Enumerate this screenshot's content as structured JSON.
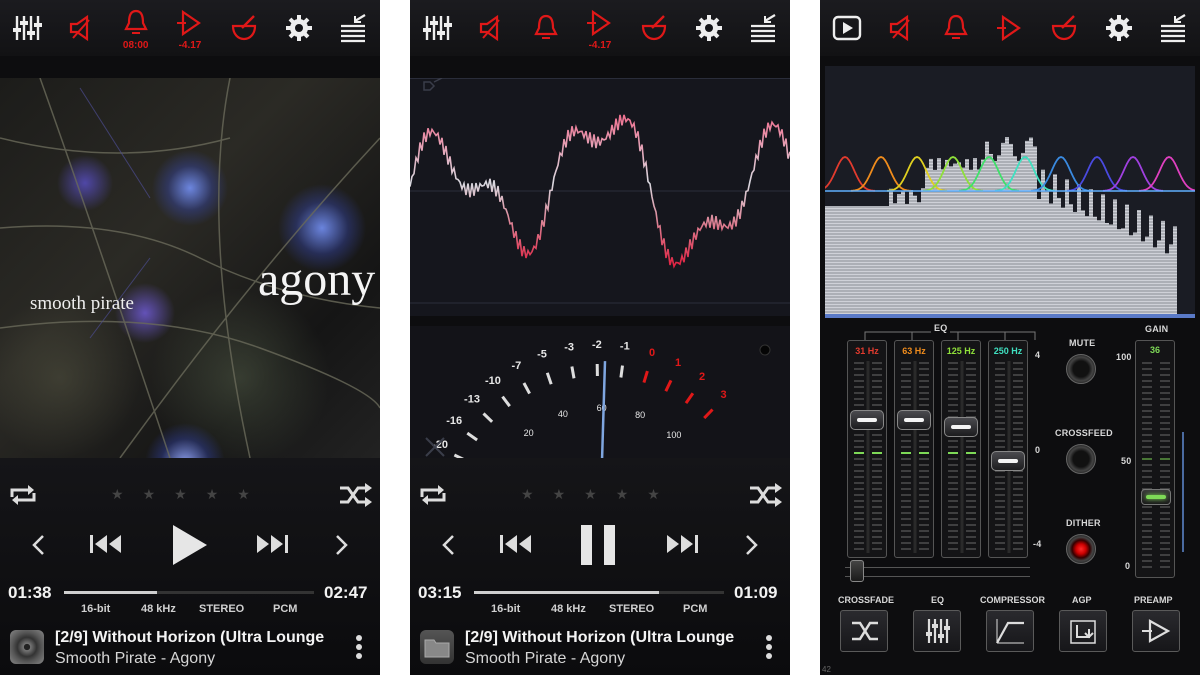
{
  "screen1": {
    "sleep_timer": "08:00",
    "replaygain": "-4.17",
    "album_art_text": {
      "title": "agony",
      "artist": "smooth pirate"
    },
    "time_elapsed": "01:38",
    "time_remaining": "02:47",
    "progress_fraction": 0.37,
    "playing": false,
    "format": {
      "bits": "16-bit",
      "rate": "48 kHz",
      "channels": "STEREO",
      "codec": "PCM"
    },
    "track_title": "[2/9] Without Horizon (Ultra Lounge",
    "track_artist_album": "Smooth Pirate - Agony",
    "rating_stars": 0
  },
  "screen2": {
    "replaygain": "-4.17",
    "time_elapsed": "03:15",
    "time_remaining": "01:09",
    "progress_fraction": 0.74,
    "playing": true,
    "format": {
      "bits": "16-bit",
      "rate": "48 kHz",
      "channels": "STEREO",
      "codec": "PCM"
    },
    "track_title": "[2/9] Without Horizon (Ultra Lounge",
    "track_artist_album": "Smooth Pirate - Agony",
    "vu_outer_scale": [
      "-20",
      "-16",
      "-13",
      "-10",
      "-7",
      "-5",
      "-3",
      "-2",
      "-1",
      "0",
      "1",
      "2",
      "3"
    ],
    "vu_inner_scale": [
      "0",
      "20",
      "40",
      "60",
      "80",
      "100"
    ],
    "vu_needle_value": -6
  },
  "screen3": {
    "eq_label": "EQ",
    "gain_label": "GAIN",
    "bands": [
      {
        "label": "31 Hz",
        "color": "#e23b2e",
        "level": 0.73
      },
      {
        "label": "63 Hz",
        "color": "#f08c1c",
        "level": 0.73
      },
      {
        "label": "125 Hz",
        "color": "#8fe03a",
        "level": 0.69
      },
      {
        "label": "250 Hz",
        "color": "#3fe0c0",
        "level": 0.5
      }
    ],
    "eq_scale": [
      "4",
      "0",
      "-4"
    ],
    "gain_value": "36",
    "gain_level": 0.36,
    "gain_scale": [
      "100",
      "50",
      "0"
    ],
    "mute_label": "MUTE",
    "crossfeed_label": "CROSSFEED",
    "dither_label": "DITHER",
    "bottom_buttons": [
      "CROSSFADE",
      "EQ",
      "COMPRESSOR",
      "AGP",
      "PREAMP"
    ],
    "corner_text": "42",
    "colors": {
      "accent_red": "#e01818",
      "eq_green": "#7ed957"
    }
  }
}
